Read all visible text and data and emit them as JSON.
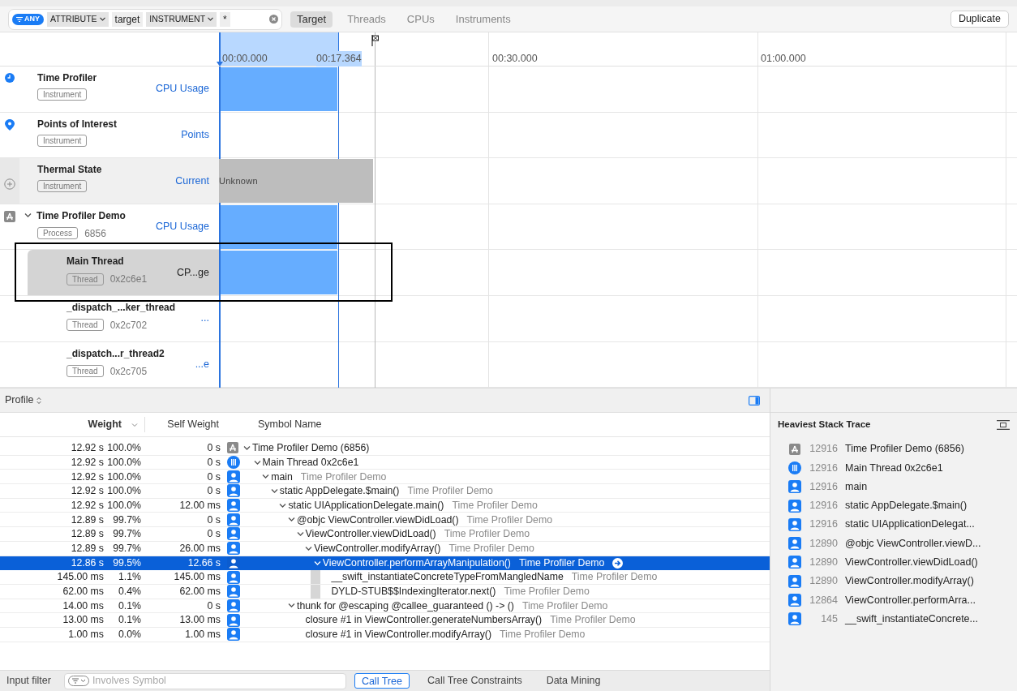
{
  "filter_bar": {
    "mode": "ANY",
    "tokens": [
      {
        "kind": "dropdown",
        "text": "ATTRIBUTE"
      },
      {
        "kind": "text",
        "text": "target"
      },
      {
        "kind": "dropdown",
        "text": "INSTRUMENT"
      },
      {
        "kind": "text",
        "text": "*"
      }
    ]
  },
  "strategy_tabs": [
    {
      "label": "Target",
      "selected": true
    },
    {
      "label": "Threads",
      "selected": false
    },
    {
      "label": "CPUs",
      "selected": false
    },
    {
      "label": "Instruments",
      "selected": false
    }
  ],
  "duplicate_button": "Duplicate",
  "ruler": {
    "start": "00:00.000",
    "selection_end": "00:17.364",
    "ticks": [
      "00:30.000",
      "01:00.000"
    ]
  },
  "tracks": [
    {
      "kind": "clock",
      "name": "Time Profiler",
      "badge": "Instrument",
      "value": "CPU Usage",
      "graph": {
        "kind": "bar"
      },
      "selected": false,
      "thread": false
    },
    {
      "kind": "pin",
      "name": "Points of Interest",
      "badge": "Instrument",
      "value": "Points",
      "graph": {
        "kind": "empty"
      },
      "selected": false,
      "thread": false
    },
    {
      "kind": "plus",
      "name": "Thermal State",
      "badge": "Instrument",
      "value": "Current",
      "graph": {
        "kind": "state",
        "text": "Unknown"
      },
      "selected": false,
      "thread": false
    },
    {
      "kind": "app",
      "expanded": true,
      "name": "Time Profiler Demo",
      "badge": "Process",
      "id": "6856",
      "value": "CPU Usage",
      "graph": {
        "kind": "bar"
      },
      "selected": false,
      "thread": false
    },
    {
      "name": "Main Thread",
      "badge": "Thread",
      "id": "0x2c6e1",
      "value": "CP...ge",
      "graph": {
        "kind": "bar"
      },
      "selected": true,
      "thread": true
    },
    {
      "name": "_dispatch_...ker_thread",
      "badge": "Thread",
      "id": "0x2c702",
      "value": "...",
      "graph": {
        "kind": "empty"
      },
      "selected": false,
      "thread": true
    },
    {
      "name": "_dispatch...r_thread2",
      "badge": "Thread",
      "id": "0x2c705",
      "value": "...e",
      "graph": {
        "kind": "empty"
      },
      "selected": false,
      "thread": true
    }
  ],
  "profile_selector": "Profile",
  "call_tree": {
    "columns": [
      "Weight",
      "Self Weight",
      "Symbol Name"
    ],
    "rows": [
      {
        "weight": "12.92 s",
        "percent": "100.0%",
        "self_weight": "0 s",
        "kind": "app",
        "symbol": "Time Profiler Demo (6856)",
        "selected": false,
        "expanded": true,
        "children": [
          {
            "weight": "12.92 s",
            "percent": "100.0%",
            "self_weight": "0 s",
            "kind": "thread",
            "symbol": "Main Thread  0x2c6e1",
            "selected": false,
            "expanded": true,
            "children": [
              {
                "weight": "12.92 s",
                "percent": "100.0%",
                "self_weight": "0 s",
                "kind": "user",
                "symbol": "main",
                "library": "Time Profiler Demo",
                "selected": false,
                "expanded": true,
                "children": [
                  {
                    "weight": "12.92 s",
                    "percent": "100.0%",
                    "self_weight": "0 s",
                    "kind": "user",
                    "symbol": "static AppDelegate.$main()",
                    "library": "Time Profiler Demo",
                    "selected": false,
                    "expanded": true,
                    "children": [
                      {
                        "weight": "12.92 s",
                        "percent": "100.0%",
                        "self_weight": "12.00 ms",
                        "kind": "user",
                        "symbol": "static UIApplicationDelegate.main()",
                        "library": "Time Profiler Demo",
                        "selected": false,
                        "expanded": true,
                        "children": [
                          {
                            "weight": "12.89 s",
                            "percent": "99.7%",
                            "self_weight": "0 s",
                            "kind": "user",
                            "symbol": "@objc ViewController.viewDidLoad()",
                            "library": "Time Profiler Demo",
                            "selected": false,
                            "expanded": true,
                            "children": [
                              {
                                "weight": "12.89 s",
                                "percent": "99.7%",
                                "self_weight": "0 s",
                                "kind": "user",
                                "symbol": "ViewController.viewDidLoad()",
                                "library": "Time Profiler Demo",
                                "selected": false,
                                "expanded": true,
                                "children": [
                                  {
                                    "weight": "12.89 s",
                                    "percent": "99.7%",
                                    "self_weight": "26.00 ms",
                                    "kind": "user",
                                    "symbol": "ViewController.modifyArray()",
                                    "library": "Time Profiler Demo",
                                    "selected": false,
                                    "expanded": true,
                                    "children": [
                                      {
                                        "weight": "12.86 s",
                                        "percent": "99.5%",
                                        "self_weight": "12.66 s",
                                        "kind": "user",
                                        "symbol": "ViewController.performArrayManipulation()",
                                        "library": "Time Profiler Demo",
                                        "selected": true,
                                        "expanded": true,
                                        "children": [
                                          {
                                            "weight": "145.00 ms",
                                            "percent": "1.1%",
                                            "self_weight": "145.00 ms",
                                            "kind": "user",
                                            "symbol": "__swift_instantiateConcreteTypeFromMangledName",
                                            "library": "Time Profiler Demo",
                                            "selected": false
                                          },
                                          {
                                            "weight": "62.00 ms",
                                            "percent": "0.4%",
                                            "self_weight": "62.00 ms",
                                            "kind": "user",
                                            "symbol": "DYLD-STUB$$IndexingIterator.next()",
                                            "library": "Time Profiler Demo",
                                            "selected": false
                                          }
                                        ]
                                      }
                                    ]
                                  }
                                ]
                              }
                            ]
                          },
                          {
                            "weight": "14.00 ms",
                            "percent": "0.1%",
                            "self_weight": "0 s",
                            "kind": "user",
                            "symbol": "thunk for @escaping @callee_guaranteed () -> ()",
                            "library": "Time Profiler Demo",
                            "selected": false,
                            "expanded": true,
                            "children": [
                              {
                                "weight": "13.00 ms",
                                "percent": "0.1%",
                                "self_weight": "13.00 ms",
                                "kind": "user",
                                "symbol": "closure #1 in ViewController.generateNumbersArray()",
                                "library": "Time Profiler Demo",
                                "selected": false
                              },
                              {
                                "weight": "1.00 ms",
                                "percent": "0.0%",
                                "self_weight": "1.00 ms",
                                "kind": "user",
                                "symbol": "closure #1 in ViewController.modifyArray()",
                                "library": "Time Profiler Demo",
                                "selected": false
                              }
                            ]
                          }
                        ]
                      }
                    ]
                  }
                ]
              }
            ]
          }
        ]
      }
    ]
  },
  "heaviest_stack": {
    "title": "Heaviest Stack Trace",
    "frames": [
      {
        "kind": "app",
        "count": "12916",
        "symbol": "Time Profiler Demo (6856)"
      },
      {
        "kind": "thread",
        "count": "12916",
        "symbol": "Main Thread  0x2c6e1"
      },
      {
        "kind": "user",
        "count": "12916",
        "symbol": "main"
      },
      {
        "kind": "user",
        "count": "12916",
        "symbol": "static AppDelegate.$main()"
      },
      {
        "kind": "user",
        "count": "12916",
        "symbol": "static UIApplicationDelegat..."
      },
      {
        "kind": "user",
        "count": "12890",
        "symbol": "@objc ViewController.viewD..."
      },
      {
        "kind": "user",
        "count": "12890",
        "symbol": "ViewController.viewDidLoad()"
      },
      {
        "kind": "user",
        "count": "12890",
        "symbol": "ViewController.modifyArray()"
      },
      {
        "kind": "user",
        "count": "12864",
        "symbol": "ViewController.performArra..."
      },
      {
        "kind": "user",
        "count": "145",
        "symbol": "__swift_instantiateConcrete..."
      }
    ]
  },
  "bottom_bar": {
    "label": "Input filter",
    "filter_placeholder": "Involves Symbol",
    "tabs": [
      {
        "label": "Call Tree",
        "selected": true
      },
      {
        "label": "Call Tree Constraints",
        "selected": false
      },
      {
        "label": "Data Mining",
        "selected": false
      }
    ]
  }
}
